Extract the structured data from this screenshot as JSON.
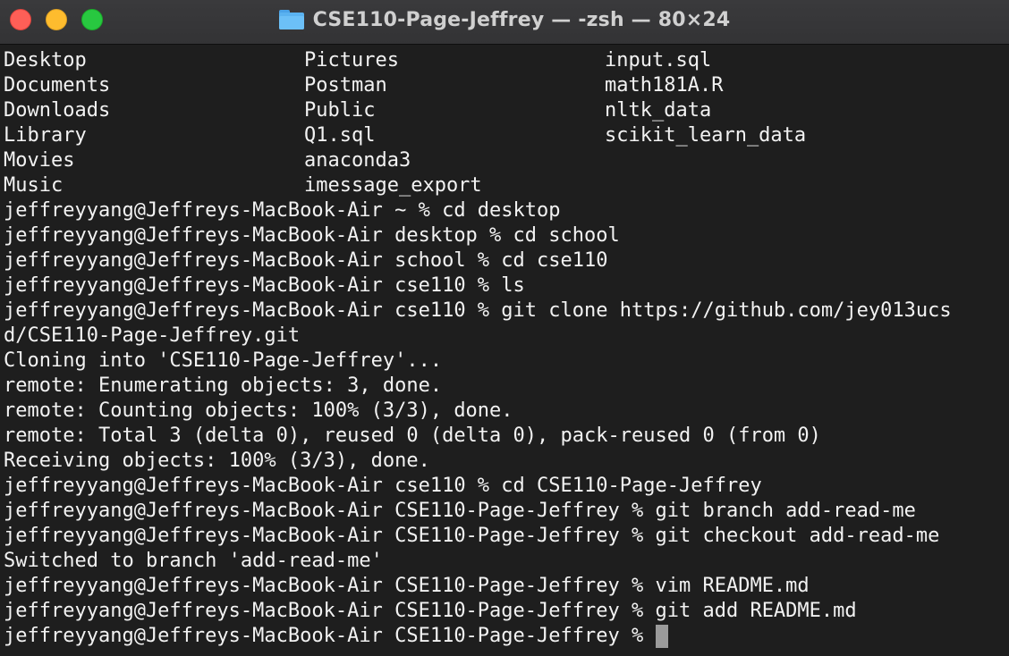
{
  "window": {
    "title": "CSE110-Page-Jeffrey — -zsh — 80×24",
    "icon": "folder-icon",
    "buttons": {
      "close": "close-button",
      "minimize": "minimize-button",
      "zoom": "zoom-button"
    },
    "colors": {
      "background": "#1e1e1e",
      "text": "#f2f2f2",
      "cursor": "#9b9b9b"
    }
  },
  "terminal": {
    "listing": [
      [
        "Desktop",
        "Pictures",
        "input.sql"
      ],
      [
        "Documents",
        "Postman",
        "math181A.R"
      ],
      [
        "Downloads",
        "Public",
        "nltk_data"
      ],
      [
        "Library",
        "Q1.sql",
        "scikit_learn_data"
      ],
      [
        "Movies",
        "anaconda3",
        ""
      ],
      [
        "Music",
        "imessage_export",
        ""
      ]
    ],
    "lines": [
      "jeffreyyang@Jeffreys-MacBook-Air ~ % cd desktop",
      "jeffreyyang@Jeffreys-MacBook-Air desktop % cd school",
      "jeffreyyang@Jeffreys-MacBook-Air school % cd cse110",
      "jeffreyyang@Jeffreys-MacBook-Air cse110 % ls",
      "jeffreyyang@Jeffreys-MacBook-Air cse110 % git clone https://github.com/jey013ucs",
      "d/CSE110-Page-Jeffrey.git",
      "Cloning into 'CSE110-Page-Jeffrey'...",
      "remote: Enumerating objects: 3, done.",
      "remote: Counting objects: 100% (3/3), done.",
      "remote: Total 3 (delta 0), reused 0 (delta 0), pack-reused 0 (from 0)",
      "Receiving objects: 100% (3/3), done.",
      "jeffreyyang@Jeffreys-MacBook-Air cse110 % cd CSE110-Page-Jeffrey",
      "jeffreyyang@Jeffreys-MacBook-Air CSE110-Page-Jeffrey % git branch add-read-me",
      "jeffreyyang@Jeffreys-MacBook-Air CSE110-Page-Jeffrey % git checkout add-read-me",
      "Switched to branch 'add-read-me'",
      "jeffreyyang@Jeffreys-MacBook-Air CSE110-Page-Jeffrey % vim README.md",
      "jeffreyyang@Jeffreys-MacBook-Air CSE110-Page-Jeffrey % git add README.md"
    ],
    "prompt": "jeffreyyang@Jeffreys-MacBook-Air CSE110-Page-Jeffrey %"
  }
}
